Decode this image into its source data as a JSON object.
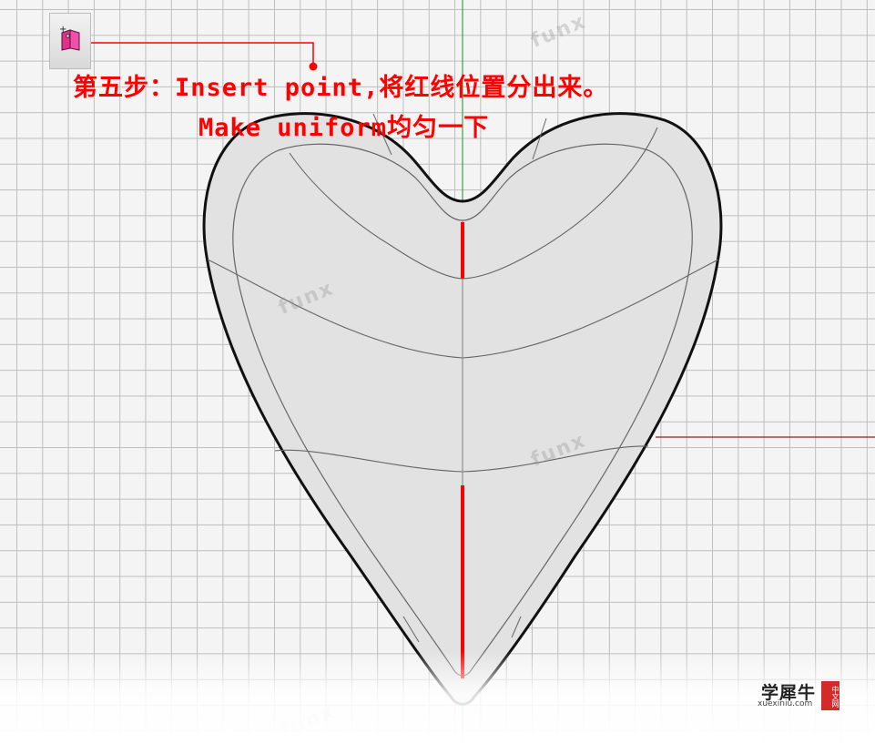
{
  "instructions": {
    "line1": "第五步：Insert point,将红线位置分出来。",
    "line2": "Make uniform均匀一下"
  },
  "toolbar": {
    "insert_point_icon": "insert-point-icon"
  },
  "watermark": {
    "text": "funx"
  },
  "logo": {
    "name": "学犀牛",
    "url": "xuexiniu.com",
    "badge": "中文网"
  },
  "colors": {
    "highlight": "#ff0000",
    "grid": "#bdbdbd",
    "surface": "#e2e2e2",
    "outline": "#111111",
    "y_axis": "#3fa046",
    "x_axis": "#8a2020"
  }
}
